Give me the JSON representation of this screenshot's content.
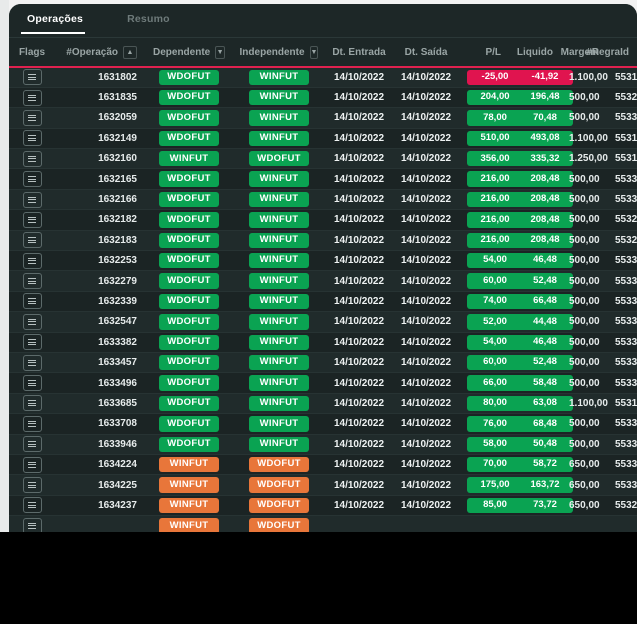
{
  "theme": {
    "panel_bg": "#1d2727",
    "row_odd": "#202b2b",
    "row_even": "#1b2424",
    "accent_line": "#e0214f",
    "badge_green": "#0aa352",
    "badge_orange": "#e8763a",
    "pill_negative": "#e0144f"
  },
  "tabs": [
    {
      "label": "Operações",
      "active": true
    },
    {
      "label": "Resumo",
      "active": false
    }
  ],
  "table": {
    "columns": [
      {
        "key": "flags",
        "label": "Flags",
        "align": "center",
        "control": null
      },
      {
        "key": "operacao",
        "label": "#Operação",
        "align": "right",
        "control": "sort-asc"
      },
      {
        "key": "dependente",
        "label": "Dependente",
        "align": "center",
        "control": "filter-dropdown"
      },
      {
        "key": "independente",
        "label": "Independente",
        "align": "center",
        "control": "filter-dropdown"
      },
      {
        "key": "dt_entrada",
        "label": "Dt. Entrada",
        "align": "center",
        "control": null
      },
      {
        "key": "dt_saida",
        "label": "Dt. Saída",
        "align": "center",
        "control": null
      },
      {
        "key": "pl",
        "label": "P/L",
        "align": "right",
        "control": null
      },
      {
        "key": "liquido",
        "label": "Liquido",
        "align": "right",
        "control": null
      },
      {
        "key": "margem",
        "label": "Margem",
        "align": "right",
        "control": null
      },
      {
        "key": "regraid",
        "label": "#RegraId",
        "align": "right",
        "control": null
      }
    ],
    "rows": [
      {
        "operacao": "1631802",
        "dependente": "WDOFUT",
        "dep_color": "green",
        "independente": "WINFUT",
        "ind_color": "green",
        "dt_entrada": "14/10/2022",
        "dt_saida": "14/10/2022",
        "pl": "-25,00",
        "pl_sign": "neg",
        "liquido": "-41,92",
        "liq_sign": "neg",
        "margem": "1.100,00",
        "regraid": "5531"
      },
      {
        "operacao": "1631835",
        "dependente": "WDOFUT",
        "dep_color": "green",
        "independente": "WINFUT",
        "ind_color": "green",
        "dt_entrada": "14/10/2022",
        "dt_saida": "14/10/2022",
        "pl": "204,00",
        "pl_sign": "pos",
        "liquido": "196,48",
        "liq_sign": "pos",
        "margem": "500,00",
        "regraid": "5532"
      },
      {
        "operacao": "1632059",
        "dependente": "WDOFUT",
        "dep_color": "green",
        "independente": "WINFUT",
        "ind_color": "green",
        "dt_entrada": "14/10/2022",
        "dt_saida": "14/10/2022",
        "pl": "78,00",
        "pl_sign": "pos",
        "liquido": "70,48",
        "liq_sign": "pos",
        "margem": "500,00",
        "regraid": "5533"
      },
      {
        "operacao": "1632149",
        "dependente": "WDOFUT",
        "dep_color": "green",
        "independente": "WINFUT",
        "ind_color": "green",
        "dt_entrada": "14/10/2022",
        "dt_saida": "14/10/2022",
        "pl": "510,00",
        "pl_sign": "pos",
        "liquido": "493,08",
        "liq_sign": "pos",
        "margem": "1.100,00",
        "regraid": "5531"
      },
      {
        "operacao": "1632160",
        "dependente": "WINFUT",
        "dep_color": "green",
        "independente": "WDOFUT",
        "ind_color": "green",
        "dt_entrada": "14/10/2022",
        "dt_saida": "14/10/2022",
        "pl": "356,00",
        "pl_sign": "pos",
        "liquido": "335,32",
        "liq_sign": "pos",
        "margem": "1.250,00",
        "regraid": "5531"
      },
      {
        "operacao": "1632165",
        "dependente": "WDOFUT",
        "dep_color": "green",
        "independente": "WINFUT",
        "ind_color": "green",
        "dt_entrada": "14/10/2022",
        "dt_saida": "14/10/2022",
        "pl": "216,00",
        "pl_sign": "pos",
        "liquido": "208,48",
        "liq_sign": "pos",
        "margem": "500,00",
        "regraid": "5533"
      },
      {
        "operacao": "1632166",
        "dependente": "WDOFUT",
        "dep_color": "green",
        "independente": "WINFUT",
        "ind_color": "green",
        "dt_entrada": "14/10/2022",
        "dt_saida": "14/10/2022",
        "pl": "216,00",
        "pl_sign": "pos",
        "liquido": "208,48",
        "liq_sign": "pos",
        "margem": "500,00",
        "regraid": "5533"
      },
      {
        "operacao": "1632182",
        "dependente": "WDOFUT",
        "dep_color": "green",
        "independente": "WINFUT",
        "ind_color": "green",
        "dt_entrada": "14/10/2022",
        "dt_saida": "14/10/2022",
        "pl": "216,00",
        "pl_sign": "pos",
        "liquido": "208,48",
        "liq_sign": "pos",
        "margem": "500,00",
        "regraid": "5532"
      },
      {
        "operacao": "1632183",
        "dependente": "WDOFUT",
        "dep_color": "green",
        "independente": "WINFUT",
        "ind_color": "green",
        "dt_entrada": "14/10/2022",
        "dt_saida": "14/10/2022",
        "pl": "216,00",
        "pl_sign": "pos",
        "liquido": "208,48",
        "liq_sign": "pos",
        "margem": "500,00",
        "regraid": "5532"
      },
      {
        "operacao": "1632253",
        "dependente": "WDOFUT",
        "dep_color": "green",
        "independente": "WINFUT",
        "ind_color": "green",
        "dt_entrada": "14/10/2022",
        "dt_saida": "14/10/2022",
        "pl": "54,00",
        "pl_sign": "pos",
        "liquido": "46,48",
        "liq_sign": "pos",
        "margem": "500,00",
        "regraid": "5533"
      },
      {
        "operacao": "1632279",
        "dependente": "WDOFUT",
        "dep_color": "green",
        "independente": "WINFUT",
        "ind_color": "green",
        "dt_entrada": "14/10/2022",
        "dt_saida": "14/10/2022",
        "pl": "60,00",
        "pl_sign": "pos",
        "liquido": "52,48",
        "liq_sign": "pos",
        "margem": "500,00",
        "regraid": "5533"
      },
      {
        "operacao": "1632339",
        "dependente": "WDOFUT",
        "dep_color": "green",
        "independente": "WINFUT",
        "ind_color": "green",
        "dt_entrada": "14/10/2022",
        "dt_saida": "14/10/2022",
        "pl": "74,00",
        "pl_sign": "pos",
        "liquido": "66,48",
        "liq_sign": "pos",
        "margem": "500,00",
        "regraid": "5533"
      },
      {
        "operacao": "1632547",
        "dependente": "WDOFUT",
        "dep_color": "green",
        "independente": "WINFUT",
        "ind_color": "green",
        "dt_entrada": "14/10/2022",
        "dt_saida": "14/10/2022",
        "pl": "52,00",
        "pl_sign": "pos",
        "liquido": "44,48",
        "liq_sign": "pos",
        "margem": "500,00",
        "regraid": "5533"
      },
      {
        "operacao": "1633382",
        "dependente": "WDOFUT",
        "dep_color": "green",
        "independente": "WINFUT",
        "ind_color": "green",
        "dt_entrada": "14/10/2022",
        "dt_saida": "14/10/2022",
        "pl": "54,00",
        "pl_sign": "pos",
        "liquido": "46,48",
        "liq_sign": "pos",
        "margem": "500,00",
        "regraid": "5533"
      },
      {
        "operacao": "1633457",
        "dependente": "WDOFUT",
        "dep_color": "green",
        "independente": "WINFUT",
        "ind_color": "green",
        "dt_entrada": "14/10/2022",
        "dt_saida": "14/10/2022",
        "pl": "60,00",
        "pl_sign": "pos",
        "liquido": "52,48",
        "liq_sign": "pos",
        "margem": "500,00",
        "regraid": "5533"
      },
      {
        "operacao": "1633496",
        "dependente": "WDOFUT",
        "dep_color": "green",
        "independente": "WINFUT",
        "ind_color": "green",
        "dt_entrada": "14/10/2022",
        "dt_saida": "14/10/2022",
        "pl": "66,00",
        "pl_sign": "pos",
        "liquido": "58,48",
        "liq_sign": "pos",
        "margem": "500,00",
        "regraid": "5533"
      },
      {
        "operacao": "1633685",
        "dependente": "WDOFUT",
        "dep_color": "green",
        "independente": "WINFUT",
        "ind_color": "green",
        "dt_entrada": "14/10/2022",
        "dt_saida": "14/10/2022",
        "pl": "80,00",
        "pl_sign": "pos",
        "liquido": "63,08",
        "liq_sign": "pos",
        "margem": "1.100,00",
        "regraid": "5531"
      },
      {
        "operacao": "1633708",
        "dependente": "WDOFUT",
        "dep_color": "green",
        "independente": "WINFUT",
        "ind_color": "green",
        "dt_entrada": "14/10/2022",
        "dt_saida": "14/10/2022",
        "pl": "76,00",
        "pl_sign": "pos",
        "liquido": "68,48",
        "liq_sign": "pos",
        "margem": "500,00",
        "regraid": "5533"
      },
      {
        "operacao": "1633946",
        "dependente": "WDOFUT",
        "dep_color": "green",
        "independente": "WINFUT",
        "ind_color": "green",
        "dt_entrada": "14/10/2022",
        "dt_saida": "14/10/2022",
        "pl": "58,00",
        "pl_sign": "pos",
        "liquido": "50,48",
        "liq_sign": "pos",
        "margem": "500,00",
        "regraid": "5533"
      },
      {
        "operacao": "1634224",
        "dependente": "WINFUT",
        "dep_color": "orange",
        "independente": "WDOFUT",
        "ind_color": "orange",
        "dt_entrada": "14/10/2022",
        "dt_saida": "14/10/2022",
        "pl": "70,00",
        "pl_sign": "pos",
        "liquido": "58,72",
        "liq_sign": "pos",
        "margem": "650,00",
        "regraid": "5533"
      },
      {
        "operacao": "1634225",
        "dependente": "WINFUT",
        "dep_color": "orange",
        "independente": "WDOFUT",
        "ind_color": "orange",
        "dt_entrada": "14/10/2022",
        "dt_saida": "14/10/2022",
        "pl": "175,00",
        "pl_sign": "pos",
        "liquido": "163,72",
        "liq_sign": "pos",
        "margem": "650,00",
        "regraid": "5533"
      },
      {
        "operacao": "1634237",
        "dependente": "WINFUT",
        "dep_color": "orange",
        "independente": "WDOFUT",
        "ind_color": "orange",
        "dt_entrada": "14/10/2022",
        "dt_saida": "14/10/2022",
        "pl": "85,00",
        "pl_sign": "pos",
        "liquido": "73,72",
        "liq_sign": "pos",
        "margem": "650,00",
        "regraid": "5532"
      },
      {
        "operacao": "",
        "dependente": "WINFUT",
        "dep_color": "orange",
        "independente": "WDOFUT",
        "ind_color": "orange",
        "dt_entrada": "",
        "dt_saida": "",
        "pl": "",
        "pl_sign": "pos",
        "liquido": "",
        "liq_sign": "pos",
        "margem": "",
        "regraid": ""
      }
    ]
  }
}
